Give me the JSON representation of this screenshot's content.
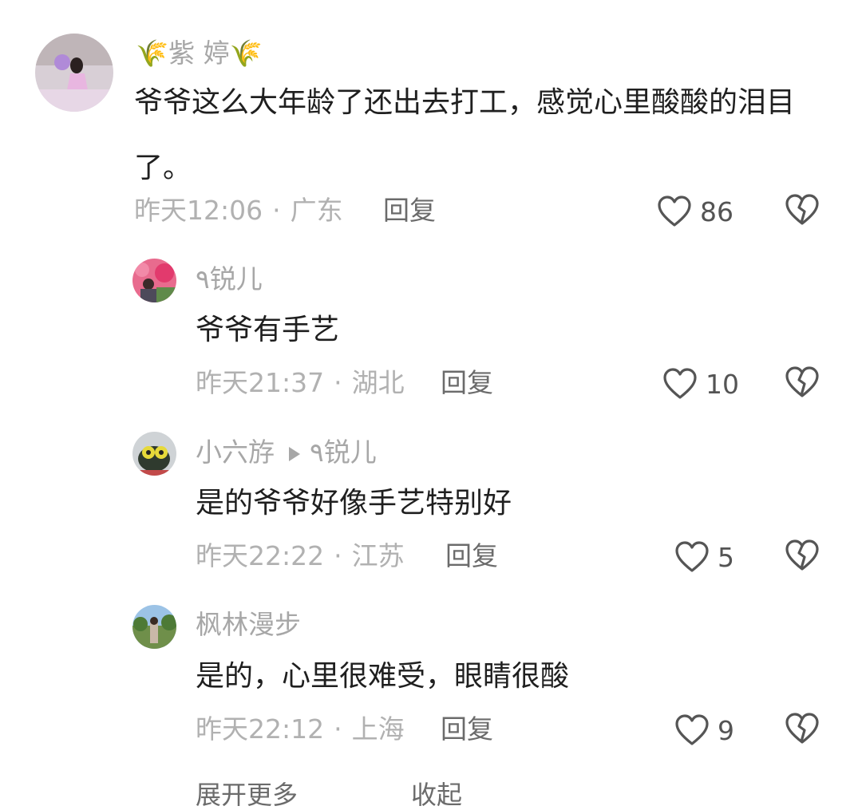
{
  "comments": [
    {
      "username": "🌾紫 婷🌾",
      "text": "爷爷这么大年龄了还出去打工，感觉心里酸酸的泪目了。",
      "time": "昨天12:06",
      "location": "广东",
      "reply_label": "回复",
      "likes": "86"
    },
    {
      "username": "٩锐儿",
      "text": "爷爷有手艺",
      "time": "昨天21:37",
      "location": "湖北",
      "reply_label": "回复",
      "likes": "10"
    },
    {
      "username": "小六斿",
      "reply_to": "٩锐儿",
      "text": "是的爷爷好像手艺特别好",
      "time": "昨天22:22",
      "location": "江苏",
      "reply_label": "回复",
      "likes": "5"
    },
    {
      "username": "枫林漫步",
      "text": "是的，心里很难受，眼睛很酸",
      "time": "昨天22:12",
      "location": "上海",
      "reply_label": "回复",
      "likes": "9"
    }
  ],
  "footer": {
    "expand_more": "展开更多",
    "collapse": "收起"
  },
  "icons": {
    "like": "heart-outline-icon",
    "dislike": "broken-heart-icon",
    "reply_arrow": "triangle-right-icon"
  },
  "colors": {
    "text": "#1f1f1f",
    "muted": "#a7a7a7",
    "count": "#545454"
  }
}
